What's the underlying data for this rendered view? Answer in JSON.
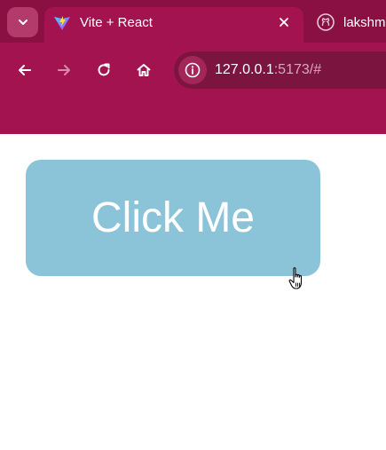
{
  "browser": {
    "tabs": [
      {
        "title": "Vite + React",
        "favicon": "vite-icon",
        "active": true
      },
      {
        "title": "lakshm",
        "favicon": "github-icon",
        "active": false
      }
    ],
    "url_host": "127.0.0.1",
    "url_rest": ":5173/#",
    "icons": {
      "tab_search": "chevron-down-icon",
      "close": "close-icon",
      "back": "back-arrow-icon",
      "forward": "forward-arrow-icon",
      "reload": "reload-icon",
      "home": "home-icon",
      "site_info": "info-icon"
    },
    "colors": {
      "chrome": "#a2134f",
      "tabstrip": "#8a0f42",
      "omnibox": "#7c1440"
    }
  },
  "page": {
    "button_label": "Click Me",
    "button_color": "#8bc4d9"
  },
  "cursor": "hand-pointer-icon"
}
